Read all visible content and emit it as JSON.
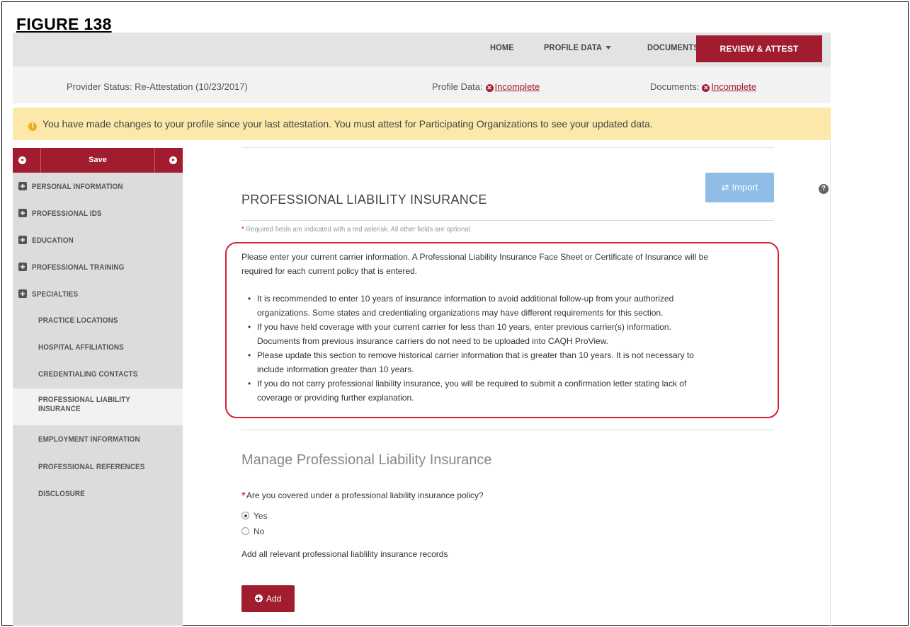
{
  "figure_label": "FIGURE 138",
  "nav": {
    "home": "HOME",
    "profile_data": "PROFILE DATA",
    "documents": "DOCUMENTS",
    "review_attest": "REVIEW & ATTEST"
  },
  "status": {
    "provider_label": "Provider Status:",
    "provider_value": "Re-Attestation (10/23/2017)",
    "profile_label": "Profile Data:",
    "profile_value": "Incomplete",
    "documents_label": "Documents:",
    "documents_value": "Incomplete"
  },
  "warning": "You have made changes to your profile since your last attestation. You must attest for Participating Organizations to see your updated data.",
  "sidebar": {
    "save_label": "Save",
    "items": [
      {
        "label": "PERSONAL INFORMATION",
        "expandable": true
      },
      {
        "label": "PROFESSIONAL IDS",
        "expandable": true
      },
      {
        "label": "EDUCATION",
        "expandable": true
      },
      {
        "label": "PROFESSIONAL TRAINING",
        "expandable": true
      },
      {
        "label": "SPECIALTIES",
        "expandable": true
      },
      {
        "label": "PRACTICE LOCATIONS",
        "expandable": false
      },
      {
        "label": "HOSPITAL AFFILIATIONS",
        "expandable": false
      },
      {
        "label": "CREDENTIALING CONTACTS",
        "expandable": false
      },
      {
        "label_line1": "PROFESSIONAL LIABILITY",
        "label_line2": "INSURANCE",
        "expandable": false,
        "active": true
      },
      {
        "label": "EMPLOYMENT INFORMATION",
        "expandable": false
      },
      {
        "label": "PROFESSIONAL REFERENCES",
        "expandable": false
      },
      {
        "label": "DISCLOSURE",
        "expandable": false
      }
    ]
  },
  "main": {
    "import_label": "Import",
    "title": "PROFESSIONAL LIABILITY INSURANCE",
    "required_note": "Required fields are indicated with a red asterisk. All other fields are optional.",
    "intro_line1": "Please enter your current carrier information. A Professional Liability Insurance Face Sheet or Certificate of Insurance will be",
    "intro_line2": "required for each current policy that is entered.",
    "bullets": [
      {
        "l1": "It is recommended to enter 10 years of insurance information to avoid additional follow-up from your authorized",
        "l2": "organizations. Some states and credentialing organizations may have different requirements for this section."
      },
      {
        "l1": "If you have held coverage with your current carrier for less than 10 years, enter previous carrier(s) information.",
        "l2": "Documents from previous insurance carriers do not need to be uploaded into CAQH ProView."
      },
      {
        "l1": "Please update this section to remove historical carrier information that is greater than 10 years. It is not necessary to",
        "l2": "include information greater than 10 years."
      },
      {
        "l1": "If you do not carry professional liability insurance, you will be required to submit a confirmation letter stating lack of",
        "l2": "coverage or providing further explanation."
      }
    ],
    "section_title": "Manage Professional Liability Insurance",
    "question": "Are you covered under a professional liability insurance policy?",
    "options": [
      "Yes",
      "No"
    ],
    "selected_option": "Yes",
    "add_note": "Add all relevant professional liablility insurance records",
    "add_label": "Add"
  },
  "colors": {
    "brand": "#a01c2e",
    "warning_bg": "#fce8a8",
    "callout_border": "#d81f2d",
    "import_btn": "#8fbde6"
  }
}
